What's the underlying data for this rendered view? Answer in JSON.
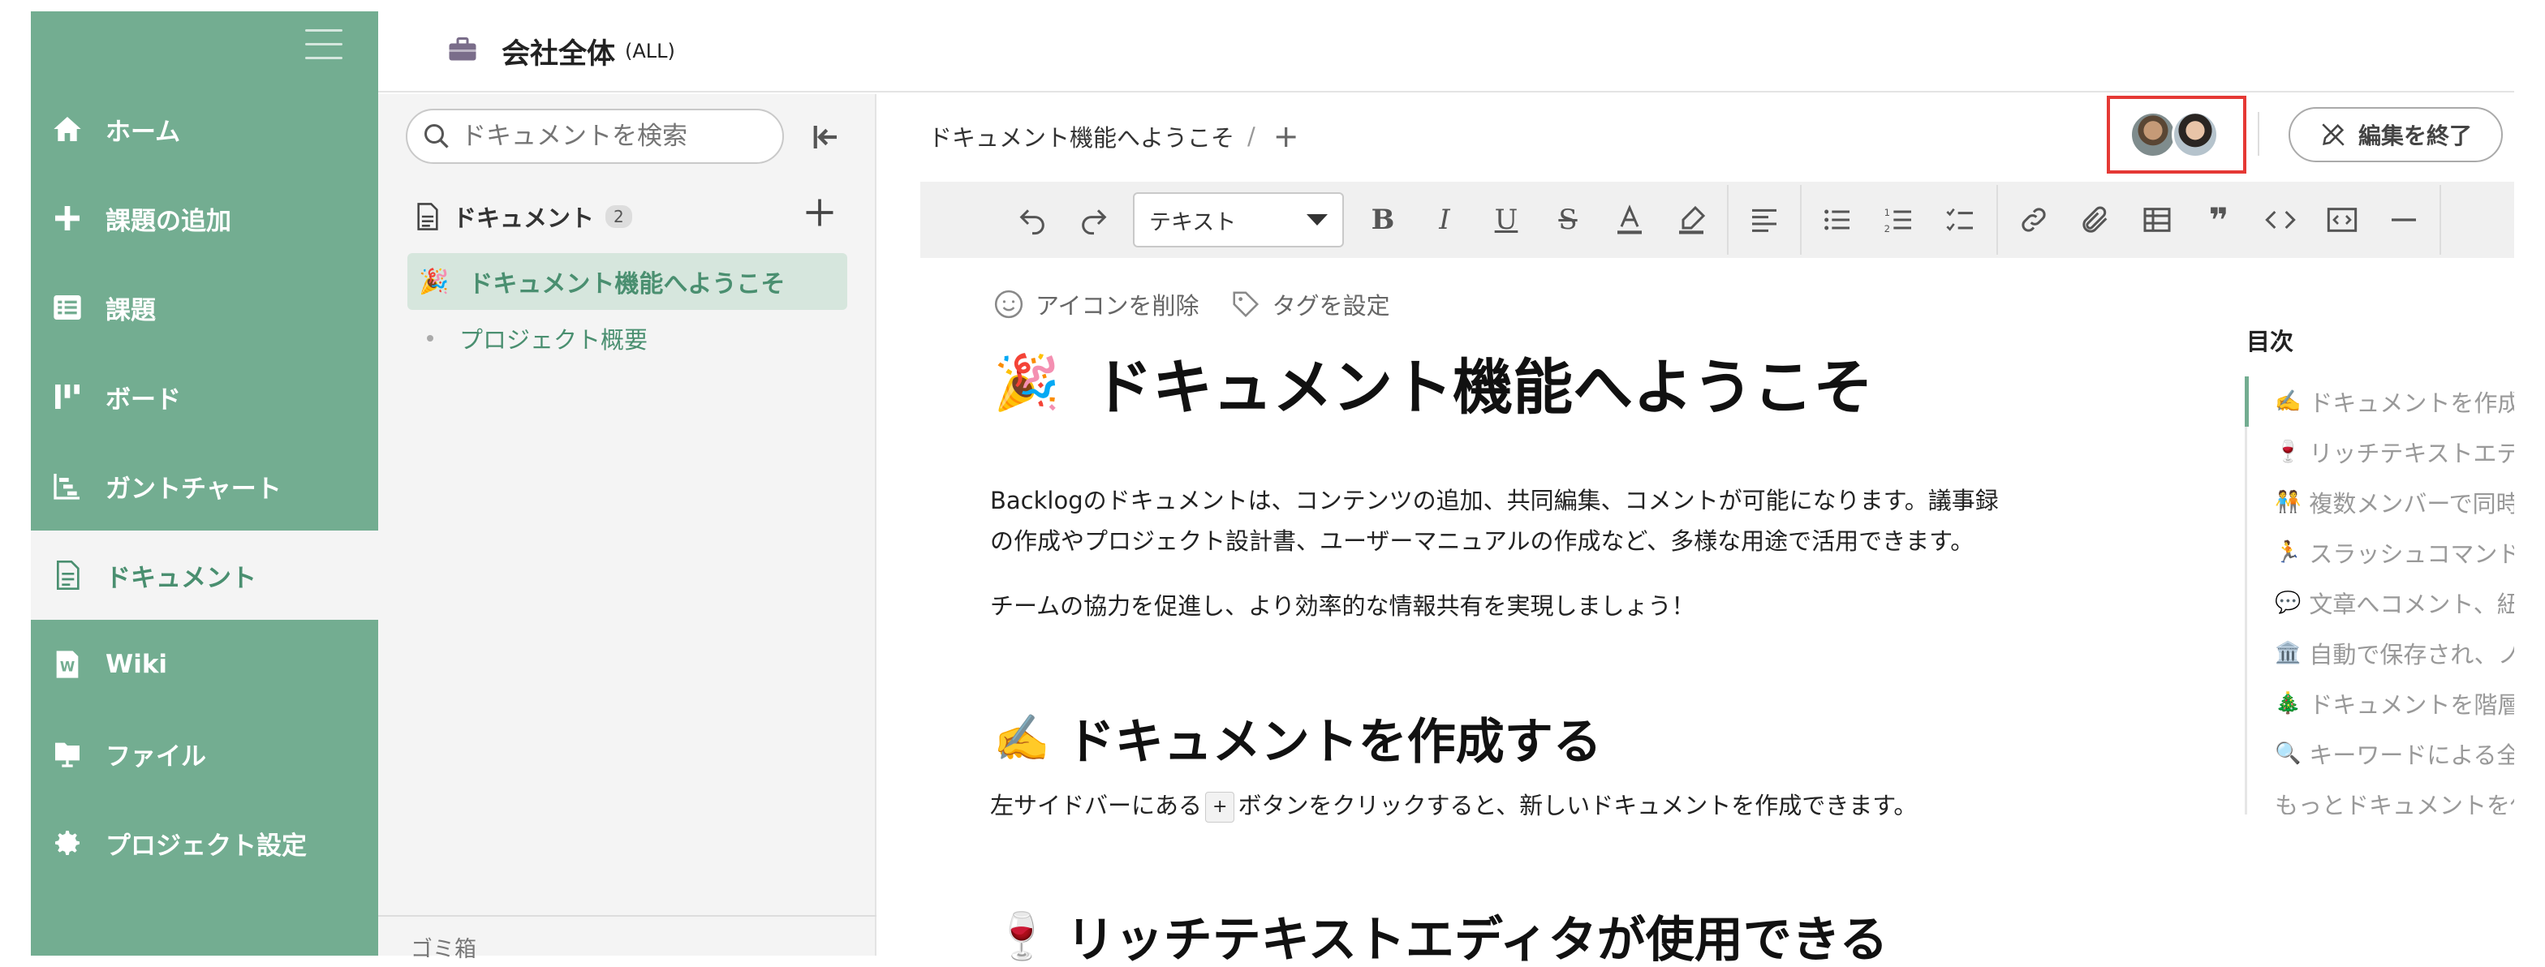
{
  "sidebar": {
    "items": [
      {
        "label": "ホーム",
        "icon": "home-icon"
      },
      {
        "label": "課題の追加",
        "icon": "plus-icon"
      },
      {
        "label": "課題",
        "icon": "list-icon"
      },
      {
        "label": "ボード",
        "icon": "board-icon"
      },
      {
        "label": "ガントチャート",
        "icon": "gantt-icon"
      },
      {
        "label": "ドキュメント",
        "icon": "document-icon"
      },
      {
        "label": "Wiki",
        "icon": "wiki-icon"
      },
      {
        "label": "ファイル",
        "icon": "file-icon"
      },
      {
        "label": "プロジェクト設定",
        "icon": "gear-icon"
      }
    ],
    "active_index": 5,
    "color": "#73ad91"
  },
  "topbar": {
    "project_name": "会社全体",
    "project_key": "(ALL)"
  },
  "docpanel": {
    "search_placeholder": "ドキュメントを検索",
    "section_title": "ドキュメント",
    "count": "2",
    "items": [
      {
        "emoji": "🎉",
        "title": "ドキュメント機能へようこそ"
      },
      {
        "title": "プロジェクト概要"
      }
    ],
    "trash_label": "ゴミ箱"
  },
  "editor": {
    "breadcrumb": "ドキュメント機能へようこそ",
    "breadcrumb_sep": "/",
    "breadcrumb_add": "+",
    "end_edit_label": "編集を終了",
    "toolbar": {
      "text_style": "テキスト"
    }
  },
  "content": {
    "remove_icon_label": "アイコンを削除",
    "set_tags_label": "タグを設定",
    "title_emoji": "🎉",
    "title": "ドキュメント機能へようこそ",
    "para1_line1": "Backlogのドキュメントは、コンテンツの追加、共同編集、コメントが可能になります。議事録",
    "para1_line2": "の作成やプロジェクト設計書、ユーザーマニュアルの作成など、多様な用途で活用できます。",
    "para2": "チームの協力を促進し、より効率的な情報共有を実現しましょう！",
    "h2_1_emoji": "✍️",
    "h2_1": "ドキュメントを作成する",
    "para3_before": "左サイドバーにある",
    "para3_kbd": "+",
    "para3_after": "ボタンをクリックすると、新しいドキュメントを作成できます。",
    "h2_2_emoji": "🍷",
    "h2_2": "リッチテキストエディタが使用できる"
  },
  "toc": {
    "title": "目次",
    "items": [
      {
        "emoji": "✍️",
        "label": "ドキュメントを作成"
      },
      {
        "emoji": "🍷",
        "label": "リッチテキストエデ"
      },
      {
        "emoji": "🧑‍🤝‍🧑",
        "label": "複数メンバーで同時"
      },
      {
        "emoji": "🏃",
        "label": "スラッシュコマンド"
      },
      {
        "emoji": "💬",
        "label": "文章へコメント、紐"
      },
      {
        "emoji": "🏛️",
        "label": "自動で保存され、ノ"
      },
      {
        "emoji": "🎄",
        "label": "ドキュメントを階層"
      },
      {
        "emoji": "🔍",
        "label": "キーワードによる全"
      },
      {
        "label": "もっとドキュメントを使"
      }
    ]
  }
}
